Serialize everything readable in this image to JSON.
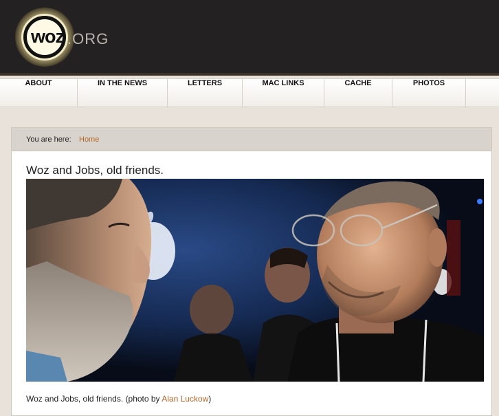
{
  "site": {
    "logo_text": "woz",
    "logo_suffix": ".ORG"
  },
  "nav": {
    "items": [
      {
        "label": "ABOUT"
      },
      {
        "label": "IN THE NEWS"
      },
      {
        "label": "LETTERS"
      },
      {
        "label": "MAC LINKS"
      },
      {
        "label": "CACHE"
      },
      {
        "label": "PHOTOS"
      }
    ]
  },
  "breadcrumb": {
    "label": "You are here:",
    "home": "Home"
  },
  "article": {
    "title": "Woz and Jobs, old friends.",
    "caption_prefix": "Woz and Jobs, old friends. (photo by ",
    "caption_author": "Alan Luckow",
    "caption_suffix": ")"
  },
  "colors": {
    "header_bg": "#232122",
    "link": "#b3662a",
    "page_bg": "#e8e2da"
  }
}
